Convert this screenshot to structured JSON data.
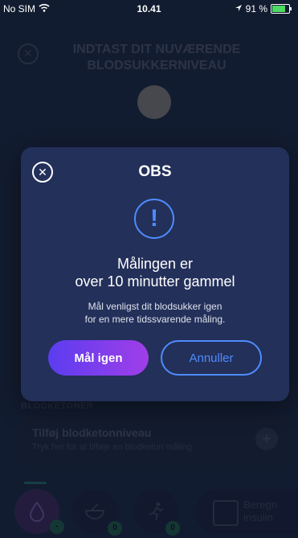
{
  "status_bar": {
    "carrier": "No SIM",
    "time": "10.41",
    "battery_percent": "91 %",
    "battery_level": 0.91
  },
  "background": {
    "title": "INDTAST DIT NUVÆRENDE BLODSUKKERNIVEAU",
    "section_label": "BLODKETONER",
    "ketone_card": {
      "title": "Tilføj blodketonniveau",
      "subtitle": "Tryk her for at tilføje en blodketon måling"
    },
    "tabs": {
      "food_badge": "0",
      "activity_badge": "0",
      "calc_label": "Beregn insulin"
    }
  },
  "modal": {
    "title": "OBS",
    "heading_line1": "Målingen er",
    "heading_line2": "over 10 minutter gammel",
    "body_line1": "Mål venligst dit blodsukker igen",
    "body_line2": "for en mere tidssvarende måling.",
    "primary_button": "Mål igen",
    "secondary_button": "Annuller"
  },
  "icons": [
    "wifi-icon",
    "location-arrow-icon",
    "battery-icon",
    "close-icon",
    "exclamation-icon",
    "blood-drop-icon",
    "food-bowl-icon",
    "running-icon",
    "calculator-icon",
    "plus-icon"
  ],
  "colors": {
    "accent_blue": "#4e8cff",
    "gradient_start": "#5b3df0",
    "gradient_end": "#a03ee8",
    "modal_bg": "#23305a"
  }
}
